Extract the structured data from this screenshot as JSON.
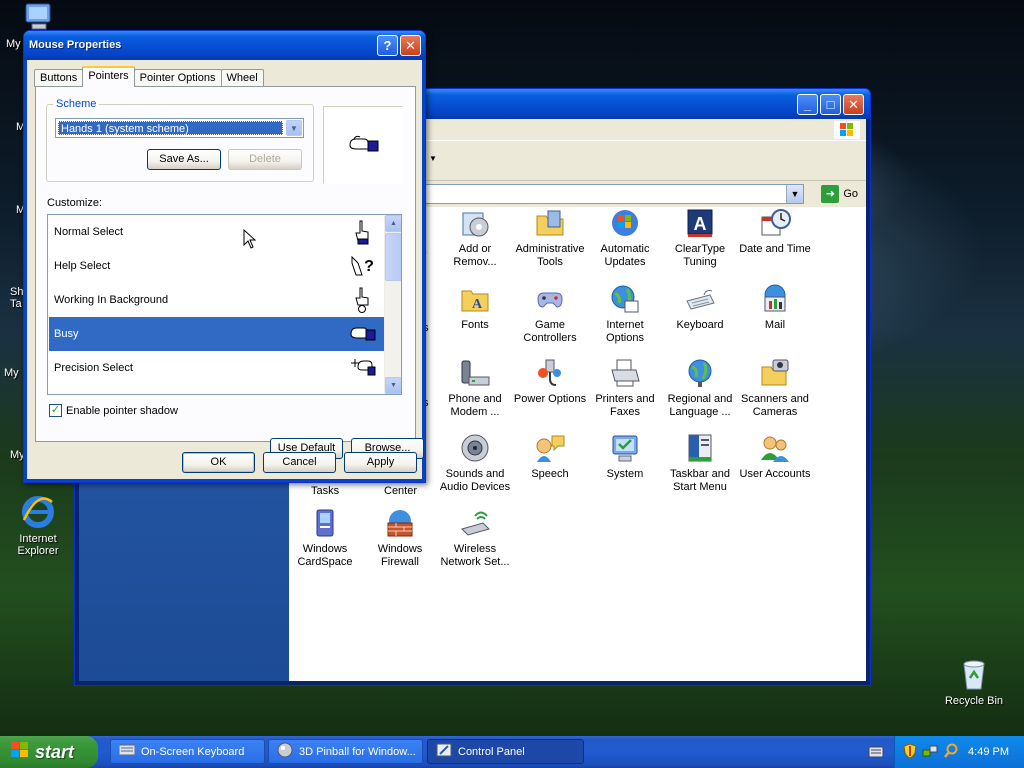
{
  "desktop": {
    "icons": [
      {
        "label": "Internet Explorer"
      },
      {
        "label": "Recycle Bin"
      }
    ],
    "partial_labels": [
      "My",
      "M",
      "M",
      "Sh",
      "Ta",
      "My",
      "My"
    ]
  },
  "control_panel": {
    "go_label": "Go",
    "partial_labels": [
      "re",
      "ns",
      "s",
      "Tasks",
      "Center"
    ],
    "items": [
      {
        "label": "Add or Remov..."
      },
      {
        "label": "Administrative Tools"
      },
      {
        "label": "Automatic Updates"
      },
      {
        "label": "ClearType Tuning"
      },
      {
        "label": "Date and Time"
      },
      {
        "label": "Fonts"
      },
      {
        "label": "Game Controllers"
      },
      {
        "label": "Internet Options"
      },
      {
        "label": "Keyboard"
      },
      {
        "label": "Mail"
      },
      {
        "label": "Phone and Modem ..."
      },
      {
        "label": "Power Options"
      },
      {
        "label": "Printers and Faxes"
      },
      {
        "label": "Regional and Language ..."
      },
      {
        "label": "Scanners and Cameras"
      },
      {
        "label": "Sounds and Audio Devices"
      },
      {
        "label": "Speech"
      },
      {
        "label": "System"
      },
      {
        "label": "Taskbar and Start Menu"
      },
      {
        "label": "User Accounts"
      },
      {
        "label": "Windows CardSpace"
      },
      {
        "label": "Windows Firewall"
      },
      {
        "label": "Wireless Network Set..."
      }
    ]
  },
  "dialog": {
    "title": "Mouse Properties",
    "help_glyph": "?",
    "close_glyph": "✕",
    "tabs": [
      "Buttons",
      "Pointers",
      "Pointer Options",
      "Wheel"
    ],
    "active_tab": "Pointers",
    "scheme_label": "Scheme",
    "scheme_value": "Hands 1 (system scheme)",
    "save_as_label": "Save As...",
    "delete_label": "Delete",
    "customize_label": "Customize:",
    "pointers": [
      {
        "label": "Normal Select",
        "selected": false
      },
      {
        "label": "Help Select",
        "selected": false
      },
      {
        "label": "Working In Background",
        "selected": false
      },
      {
        "label": "Busy",
        "selected": true
      },
      {
        "label": "Precision Select",
        "selected": false
      }
    ],
    "shadow_label": "Enable pointer shadow",
    "shadow_checked": true,
    "use_default_label": "Use Default",
    "browse_label": "Browse...",
    "ok_label": "OK",
    "cancel_label": "Cancel",
    "apply_label": "Apply"
  },
  "taskbar": {
    "start_label": "start",
    "tasks": [
      {
        "label": "On-Screen Keyboard",
        "active": false
      },
      {
        "label": "3D Pinball for Window...",
        "active": false
      },
      {
        "label": "Control Panel",
        "active": true
      }
    ],
    "clock": "4:49 PM"
  },
  "colors": {
    "xp_blue": "#0544c8",
    "selection": "#316ac5",
    "start_green": "#3c9a3c"
  }
}
